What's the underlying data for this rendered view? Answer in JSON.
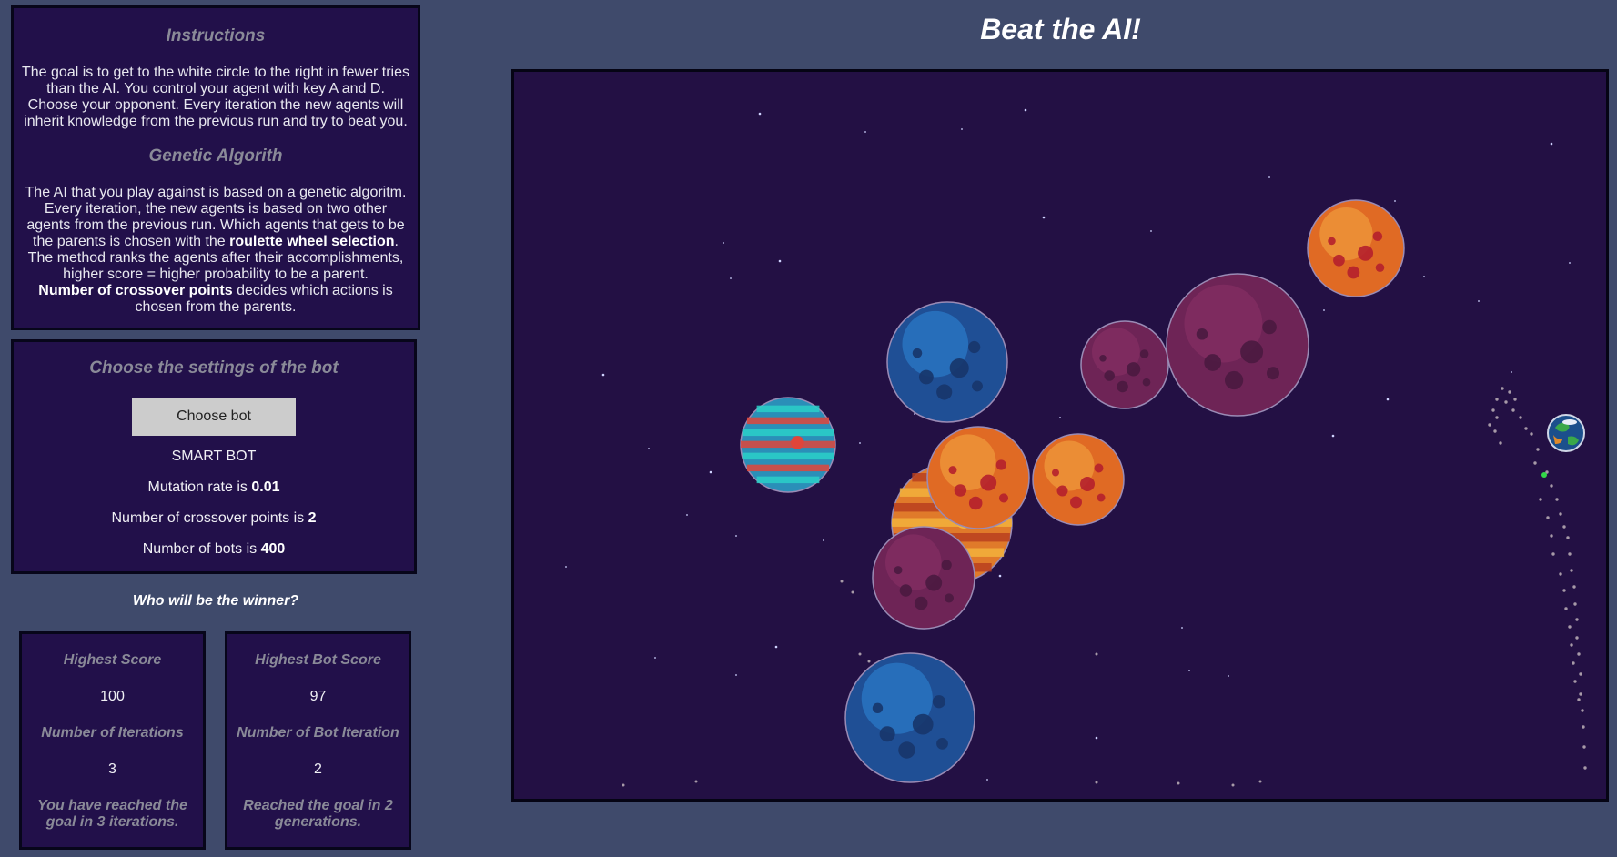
{
  "instructions": {
    "title": "Instructions",
    "text": "The goal is to get to the white circle to the right in fewer tries than the AI. You control your agent with key A and D. Choose your opponent. Every iteration the new agents will inherit knowledge from the previous run and try to beat you.",
    "ga_title": "Genetic Algorith",
    "ga_text_1": "The AI that you play against is based on a genetic algoritm. Every iteration, the new agents is based on two other agents from the previous run. Which agents that gets to be the parents is chosen with the ",
    "ga_bold_1": "roulette wheel selection",
    "ga_text_2": ". The method ranks the agents after their accomplishments, higher score = higher probability to be a parent.",
    "ga_bold_2": "Number of crossover points",
    "ga_text_3": " decides which actions is chosen from the parents."
  },
  "settings": {
    "title": "Choose the settings of the bot",
    "button": "Choose bot",
    "bot_type": "SMART BOT",
    "mutation_label": "Mutation rate is ",
    "mutation_value": "0.01",
    "crossover_label": "Number of crossover points is ",
    "crossover_value": "2",
    "bots_label": "Number of bots is ",
    "bots_value": "400"
  },
  "winner_question": "Who will be the winner?",
  "player": {
    "score_label": "Highest Score",
    "score": "100",
    "iter_label": "Number of Iterations",
    "iterations": "3",
    "message": "You have reached the goal in 3 iterations."
  },
  "bot": {
    "score_label": "Highest Bot Score",
    "score": "97",
    "iter_label": "Number of Bot Iteration",
    "iterations": "2",
    "message": "Reached the goal in 2 generations."
  },
  "game_title": "Beat the AI!",
  "colors": {
    "page_bg": "#3f4a6b",
    "panel_bg": "#22104a",
    "canvas_bg": "#231044"
  },
  "planets": [
    {
      "kind": "candy-planet-icon",
      "c1": "#2a8fb8",
      "c2": "#e0453a",
      "c3": "#2ad0c8"
    },
    {
      "kind": "blue-cratered-planet-icon",
      "c1": "#1f4f95",
      "c2": "#2e88d8",
      "c3": "#17356a"
    },
    {
      "kind": "orange-banded-planet-icon",
      "c1": "#e07a2a",
      "c2": "#f2b23c",
      "c3": "#b8401e"
    },
    {
      "kind": "orange-cratered-planet-icon",
      "c1": "#e06a24",
      "c2": "#f4aa44",
      "c3": "#b5202c"
    },
    {
      "kind": "orange-cratered-planet-icon",
      "c1": "#e06a24",
      "c2": "#f4aa44",
      "c3": "#b5202c"
    },
    {
      "kind": "purple-cratered-planet-icon",
      "c1": "#6e2456",
      "c2": "#8c3268",
      "c3": "#4a1a40"
    },
    {
      "kind": "purple-cratered-planet-icon",
      "c1": "#6e2456",
      "c2": "#8c3268",
      "c3": "#4a1a40"
    },
    {
      "kind": "purple-cratered-planet-icon",
      "c1": "#6e2456",
      "c2": "#8c3268",
      "c3": "#4a1a40"
    },
    {
      "kind": "orange-cratered-planet-icon",
      "c1": "#e06a24",
      "c2": "#f4aa44",
      "c3": "#b5202c"
    },
    {
      "kind": "blue-cratered-planet-icon",
      "c1": "#1f4f95",
      "c2": "#2e88d8",
      "c3": "#17356a"
    }
  ]
}
